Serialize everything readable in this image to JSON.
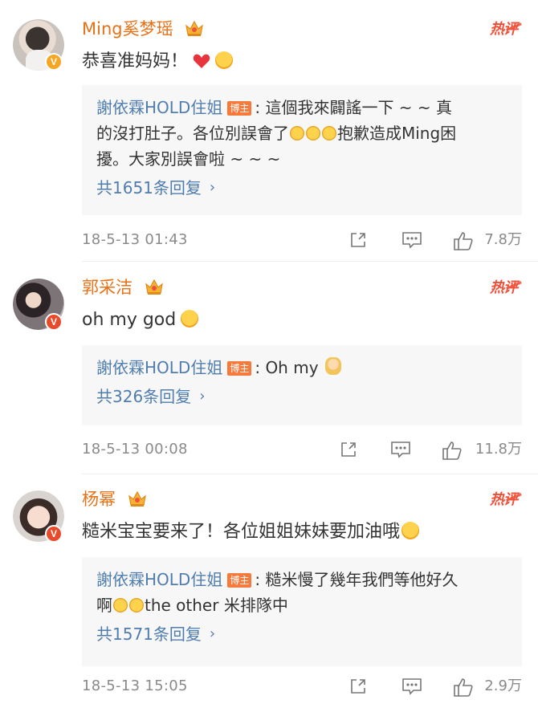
{
  "comments": [
    {
      "username": "Ming奚梦瑶",
      "hot_label": "热评",
      "text": "恭喜准妈妈！",
      "reply": {
        "author": "謝依霖HOLD住姐",
        "author_badge": "博主",
        "text_line1": ": 這個我來闢謠一下 ~ ~ 真",
        "text_line2a": "的沒打肚子。各位別誤會了",
        "text_line2b": "抱歉造成Ming困",
        "text_line3": "擾。大家別誤會啦 ~ ~ ~",
        "count_label": "共1651条回复"
      },
      "timestamp": "18-5-13 01:43",
      "likes": "7.8万"
    },
    {
      "username": "郭采洁",
      "hot_label": "热评",
      "text": "oh my god",
      "reply": {
        "author": "謝依霖HOLD住姐",
        "author_badge": "博主",
        "text_line1": ": Oh my",
        "count_label": "共326条回复"
      },
      "timestamp": "18-5-13 00:08",
      "likes": "11.8万"
    },
    {
      "username": "杨幂",
      "hot_label": "热评",
      "text": "糙米宝宝要来了！各位姐姐妹妹要加油哦",
      "reply": {
        "author": "謝依霖HOLD住姐",
        "author_badge": "博主",
        "text_line1": ": 糙米慢了幾年我們等他好久",
        "text_line2a": "啊",
        "text_line2b": "the other 米排隊中",
        "count_label": "共1571条回复"
      },
      "timestamp": "18-5-13 15:05",
      "likes": "2.9万"
    }
  ],
  "colors": {
    "username": "#e67117",
    "reply_author": "#507daf",
    "hot": "#f0513a",
    "badge_bg": "#f77a3d",
    "verified": "#f5a623",
    "verified_red": "#e94a2a"
  },
  "icons": {
    "crown": "crown-icon",
    "share": "share-icon",
    "comment": "comment-icon",
    "like": "thumbs-up-icon",
    "verified": "verified-v-icon",
    "chevron": "chevron-right-icon"
  },
  "verified_letter": "V",
  "chevron_glyph": "›"
}
